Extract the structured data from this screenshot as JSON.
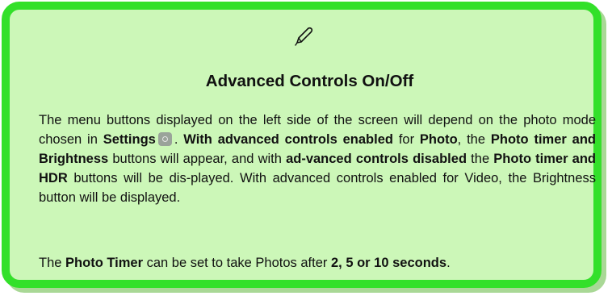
{
  "note": {
    "icon": "pencil-note-icon",
    "title": "Advanced Controls On/Off",
    "p1": {
      "t1": "The menu buttons displayed on the left side of the screen will depend on the photo mode chosen in ",
      "b1": "Settings",
      "settings_icon": "settings-gear-icon",
      "t2": ". ",
      "b2": "With advanced controls enabled",
      "t3": " for ",
      "b3": "Photo",
      "t4": ", the ",
      "b4": "Photo timer and Brightness",
      "t5": " buttons will appear, and with ",
      "b5": "ad-vanced controls disabled",
      "t6": " the ",
      "b6": "Photo timer and HDR",
      "t7": " buttons will be dis-played. With advanced controls enabled for Video, the Brightness button will be displayed."
    },
    "p2": {
      "t1": "The ",
      "b1": "Photo Timer",
      "t2": " can be set to take Photos after ",
      "b2": "2, 5 or 10 seconds",
      "t3": "."
    }
  }
}
